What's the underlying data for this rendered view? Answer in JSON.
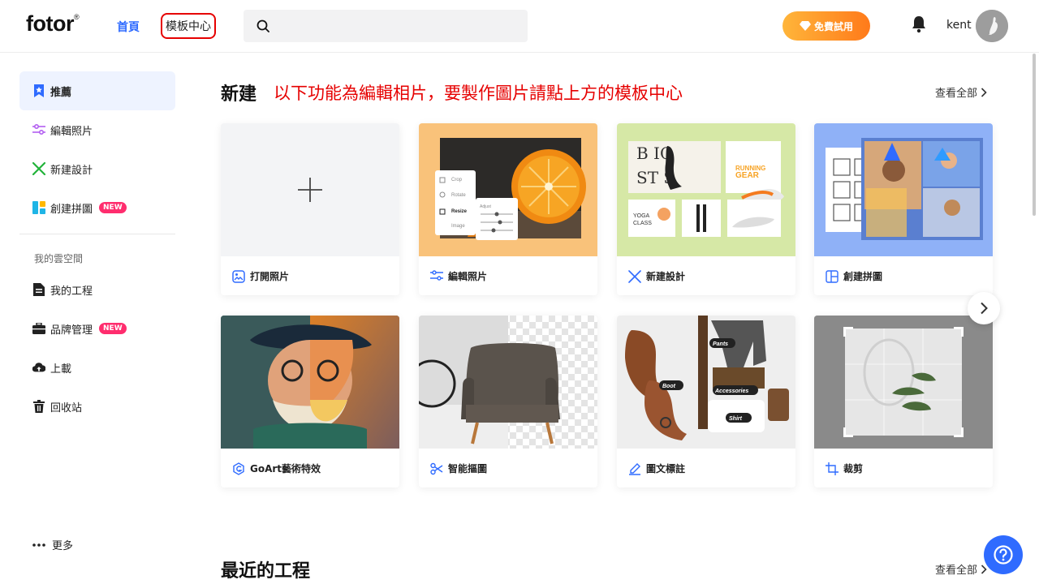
{
  "header": {
    "logo": "fotor",
    "logo_mark": "®",
    "nav_home": "首頁",
    "nav_templates": "模板中心",
    "search_placeholder": "",
    "trial_button": "免費試用",
    "username": "kent"
  },
  "sidebar": {
    "items": [
      {
        "label": "推薦",
        "icon": "bookmark-star-icon"
      },
      {
        "label": "編輯照片",
        "icon": "sliders-icon"
      },
      {
        "label": "新建設計",
        "icon": "design-tools-icon"
      },
      {
        "label": "創建拼圖",
        "icon": "collage-icon",
        "badge": "NEW"
      }
    ],
    "section_label": "我的雲空間",
    "cloud_items": [
      {
        "label": "我的工程",
        "icon": "document-icon"
      },
      {
        "label": "品牌管理",
        "icon": "briefcase-icon",
        "badge": "NEW"
      },
      {
        "label": "上載",
        "icon": "cloud-upload-icon"
      },
      {
        "label": "回收站",
        "icon": "trash-icon"
      }
    ],
    "more_label": "更多"
  },
  "main": {
    "section_title": "新建",
    "annotation": "以下功能為編輯相片，要製作圖片請點上方的模板中心",
    "view_all": "查看全部",
    "cards": [
      {
        "label": "打開照片",
        "icon": "image-open-icon"
      },
      {
        "label": "編輯照片",
        "icon": "sliders-icon"
      },
      {
        "label": "新建設計",
        "icon": "design-tools-icon"
      },
      {
        "label": "創建拼圖",
        "icon": "collage-icon"
      },
      {
        "label": "GoArt藝術特效",
        "icon": "goart-icon"
      },
      {
        "label": "智能摳圖",
        "icon": "scissors-icon"
      },
      {
        "label": "圖文標註",
        "icon": "pen-icon"
      },
      {
        "label": "裁剪",
        "icon": "crop-icon"
      }
    ],
    "thumb_text": {
      "crop": "Crop",
      "rotate": "Rotate",
      "resize": "Resize",
      "image": "Image",
      "adjust": "Adjust",
      "basic": "B  IC",
      "stars": "ST  S",
      "running": "RUNNING",
      "gear": "GEAR",
      "yoga": "YOGA",
      "class": "CLASS",
      "pants": "Pants",
      "boot": "Boot",
      "accessories": "Accessories",
      "shirt": "Shirt"
    },
    "recent_title": "最近的工程",
    "recent_view_all": "查看全部"
  },
  "colors": {
    "accent": "#2f6bff",
    "annotation": "#e60000",
    "badge": "#ff2d6e"
  }
}
